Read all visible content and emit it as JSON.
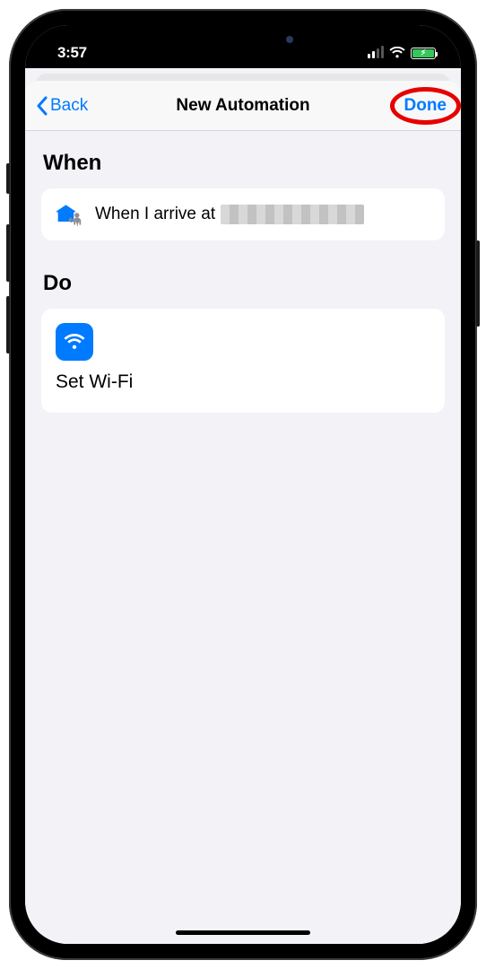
{
  "status": {
    "time": "3:57"
  },
  "nav": {
    "back": "Back",
    "title": "New Automation",
    "done": "Done"
  },
  "when": {
    "heading": "When",
    "triggerPrefix": "When I arrive at"
  },
  "do": {
    "heading": "Do",
    "action": "Set Wi-Fi"
  }
}
